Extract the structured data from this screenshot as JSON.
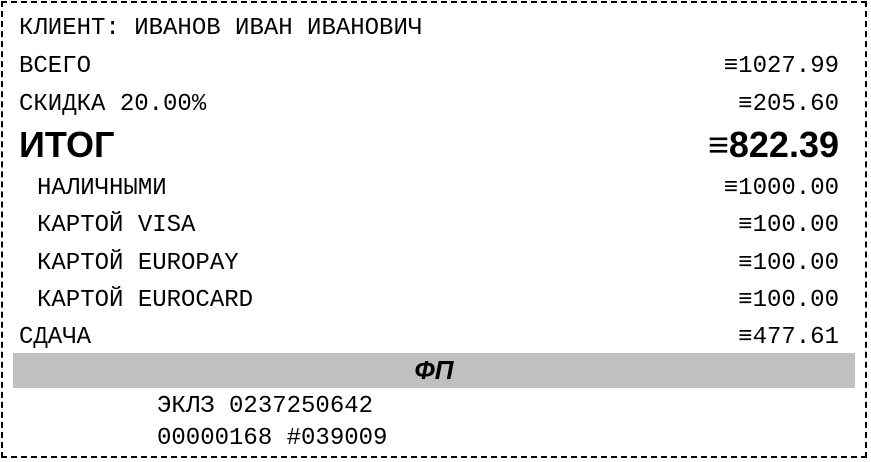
{
  "receipt": {
    "client": "КЛИЕНТ: ИВАНОВ ИВАН ИВАНОВИЧ",
    "subtotal": {
      "label": "ВСЕГО",
      "value": "≡1027.99"
    },
    "discount": {
      "label": "СКИДКА 20.00%",
      "value": "≡205.60"
    },
    "total": {
      "label": "ИТОГ",
      "value": "≡822.39"
    },
    "payments": [
      {
        "label": "НАЛИЧНЫМИ",
        "value": "≡1000.00"
      },
      {
        "label": "КАРТОЙ VISA",
        "value": "≡100.00"
      },
      {
        "label": "КАРТОЙ EUROPAY",
        "value": "≡100.00"
      },
      {
        "label": "КАРТОЙ EUROCARD",
        "value": "≡100.00"
      }
    ],
    "change": {
      "label": "СДАЧА",
      "value": "≡477.61"
    },
    "fp_label": "ФП",
    "eklz_line1": "ЭКЛЗ 0237250642",
    "eklz_line2": "00000168 #039009"
  }
}
